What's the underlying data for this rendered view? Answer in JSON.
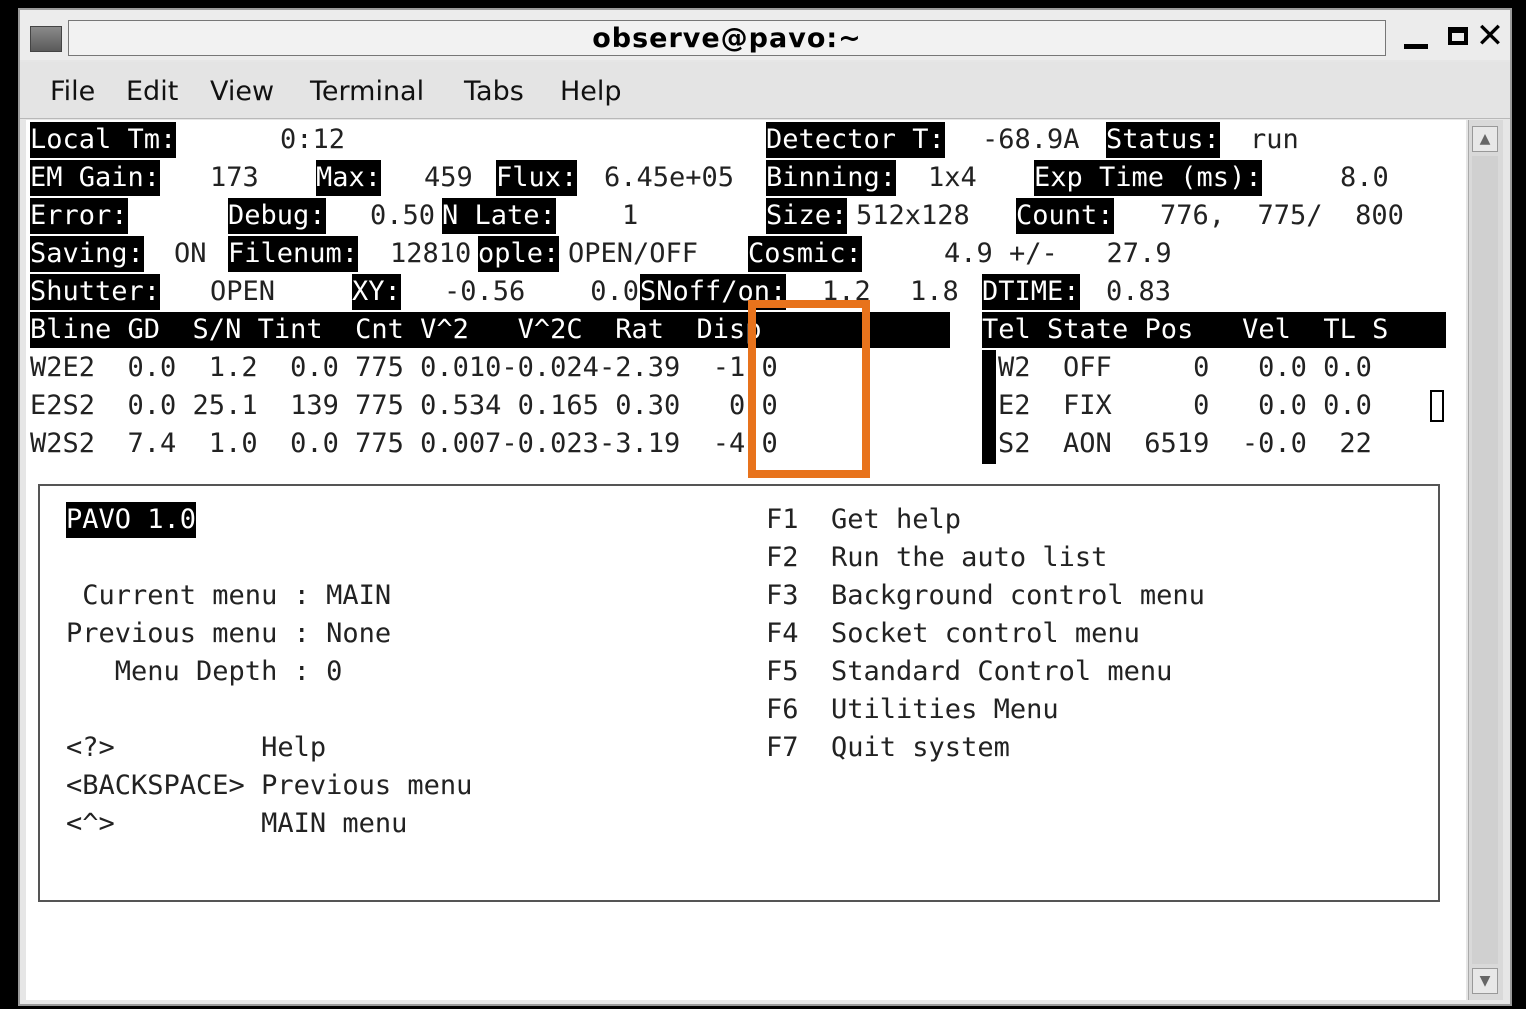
{
  "window": {
    "title": "observe@pavo:~"
  },
  "menu": [
    "File",
    "Edit",
    "View",
    "Terminal",
    "Tabs",
    "Help"
  ],
  "status": {
    "local_tm_label": "Local Tm:",
    "local_tm_value": "0:12",
    "detector_t_label": "Detector T:",
    "detector_t_value": "-68.9A",
    "status_label": "Status:",
    "status_value": "run",
    "em_gain_label": "EM Gain:",
    "em_gain_value": "173",
    "max_label": "Max:",
    "max_value": "459",
    "flux_label": "Flux:",
    "flux_value": "6.45e+05",
    "binning_label": "Binning:",
    "binning_value": "1x4",
    "exp_time_label": "Exp Time (ms):",
    "exp_time_value": "8.0",
    "error_label": "Error:",
    "debug_label": "Debug:",
    "debug_value": "0.50",
    "n_late_label": "N Late:",
    "n_late_value": "1",
    "size_label": "Size:",
    "size_value": "512x128",
    "count_label": "Count:",
    "count_value": "776,  775/  800",
    "saving_label": "Saving:",
    "saving_value": "ON",
    "filenum_label": "Filenum:",
    "filenum_value": "12810",
    "ople_label": "ople:",
    "ople_value": "OPEN/OFF",
    "cosmic_label": "Cosmic:",
    "cosmic_value": "4.9 +/-   27.9",
    "shutter_label": "Shutter:",
    "shutter_value": "OPEN",
    "xy_label": "XY:",
    "xy_value": "-0.56    0.0",
    "snoff_label": "SNoff/on:",
    "snoff_value": "1.2",
    "snoff_value2": "1.8",
    "dtime_label": "DTIME:",
    "dtime_value": "0.83"
  },
  "baseline_table": {
    "header": "Bline GD  S/N Tint  Cnt V^2   V^2C  Rat  Disp",
    "rows": [
      "W2E2  0.0  1.2  0.0 775 0.010-0.024-2.39  -1.0",
      "E2S2  0.0 25.1  139 775 0.534 0.165 0.30   0.0",
      "W2S2  7.4  1.0  0.0 775 0.007-0.023-3.19  -4.0"
    ]
  },
  "telescope_table": {
    "header": "Tel State Pos   Vel  TL S",
    "rows": [
      "W2  OFF     0   0.0 0.0",
      "E2  FIX     0   0.0 0.0",
      "S2  AON  6519  -0.0  22"
    ]
  },
  "menu_panel": {
    "title": "PAVO 1.0",
    "current_menu": " Current menu : MAIN",
    "previous_menu": "Previous menu : None",
    "menu_depth": "   Menu Depth : 0",
    "keys": [
      "<?>         Help",
      "<BACKSPACE> Previous menu",
      "<^>         MAIN menu"
    ],
    "functions": [
      "F1  Get help",
      "F2  Run the auto list",
      "F3  Background control menu",
      "F4  Socket control menu",
      "F5  Standard Control menu",
      "F6  Utilities Menu",
      "F7  Quit system"
    ]
  },
  "icons": {
    "close": "✕"
  },
  "colors": {
    "highlight": "#e8731c"
  }
}
